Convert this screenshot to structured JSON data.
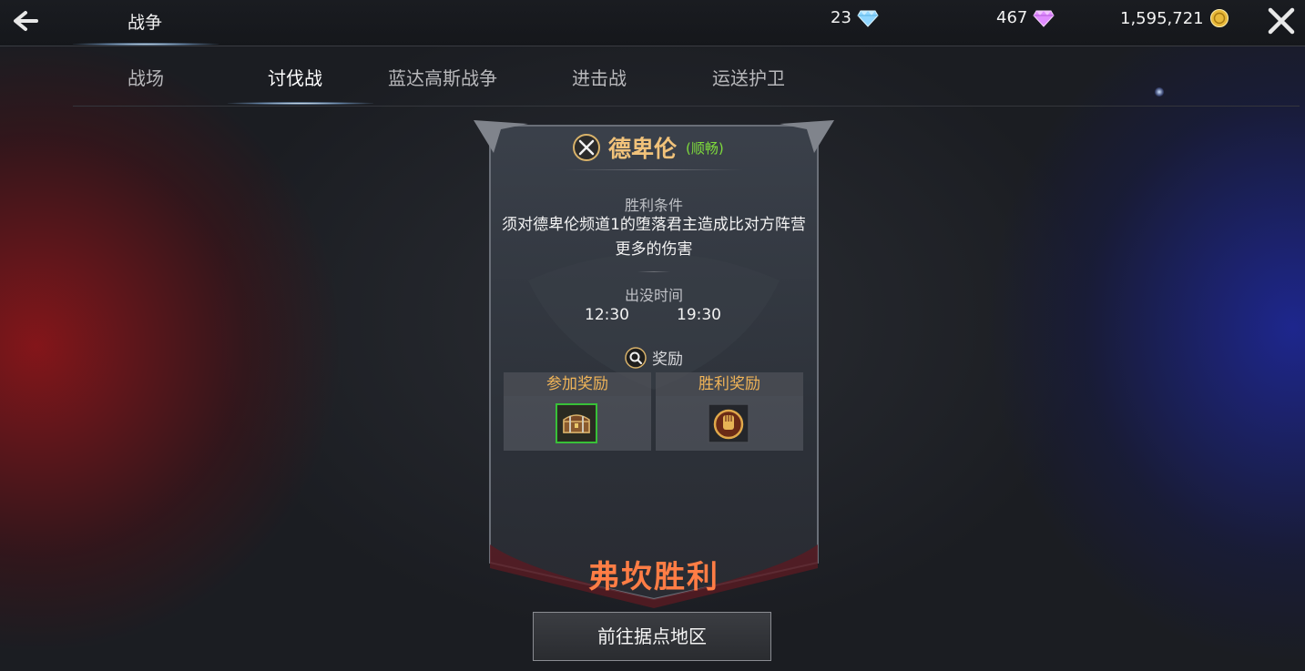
{
  "header": {
    "title": "战争",
    "currencies": [
      {
        "icon": "blue-diamond-icon",
        "value": "23",
        "color": "#8fd6ff"
      },
      {
        "icon": "purple-diamond-icon",
        "value": "467",
        "color": "#e08cff"
      },
      {
        "icon": "gold-coin-icon",
        "value": "1,595,721",
        "color": "#e8b93a"
      }
    ]
  },
  "tabs": [
    {
      "label": "战场",
      "active": false
    },
    {
      "label": "讨伐战",
      "active": true
    },
    {
      "label": "蓝达高斯战争",
      "active": false
    },
    {
      "label": "进击战",
      "active": false
    },
    {
      "label": "运送护卫",
      "active": false
    }
  ],
  "boss": {
    "name": "德卑伦",
    "status": "(顺畅)",
    "status_color": "#7fdc3c"
  },
  "victory_condition": {
    "label": "胜利条件",
    "text": "须对德卑伦频道1的堕落君主造成比对方阵营更多的伤害"
  },
  "appearance": {
    "label": "出没时间",
    "times": [
      "12:30",
      "19:30"
    ]
  },
  "rewards": {
    "label": "奖励",
    "participation": {
      "label": "参加奖励",
      "item_icon": "treasure-chest-icon"
    },
    "victory": {
      "label": "胜利奖励",
      "item_icon": "gold-fist-medal-icon"
    }
  },
  "result": {
    "text": "弗坎胜利",
    "color": "#ff7d45"
  },
  "actions": {
    "goto_label": "前往据点地区"
  }
}
